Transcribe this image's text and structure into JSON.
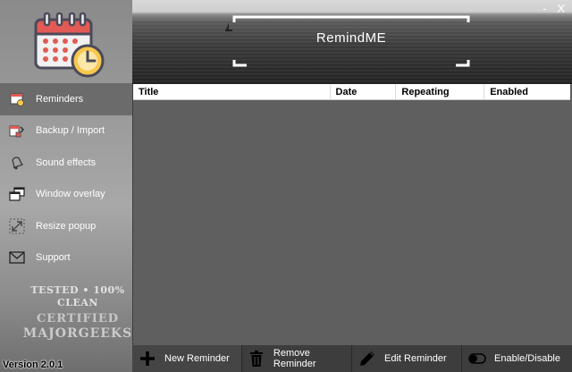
{
  "window": {
    "minimize_label": "-",
    "close_label": "X"
  },
  "banner": {
    "title": "RemindME"
  },
  "sidebar": {
    "items": [
      {
        "label": "Reminders",
        "icon": "reminder-list-icon",
        "active": true
      },
      {
        "label": "Backup / Import",
        "icon": "backup-import-icon",
        "active": false
      },
      {
        "label": "Sound effects",
        "icon": "bell-icon",
        "active": false
      },
      {
        "label": "Window overlay",
        "icon": "window-overlay-icon",
        "active": false
      },
      {
        "label": "Resize popup",
        "icon": "resize-icon",
        "active": false
      },
      {
        "label": "Support",
        "icon": "envelope-icon",
        "active": false
      }
    ],
    "watermark": {
      "line1": "TESTED • 100% CLEAN",
      "line2": "CERTIFIED",
      "line3": "MAJORGEEKS"
    },
    "version": "Version 2.0.1"
  },
  "table": {
    "columns": [
      "Title",
      "Date",
      "Repeating",
      "Enabled"
    ],
    "rows": []
  },
  "toolbar": {
    "new_label": "New Reminder",
    "remove_label": "Remove Reminder",
    "edit_label": "Edit Reminder",
    "toggle_label": "Enable/Disable"
  },
  "colors": {
    "sidebar_active": "#6b6b6b",
    "toolbar_bg": "#3d3d3d",
    "table_bg": "#5f5f5f",
    "calendar_red": "#e25a55"
  }
}
